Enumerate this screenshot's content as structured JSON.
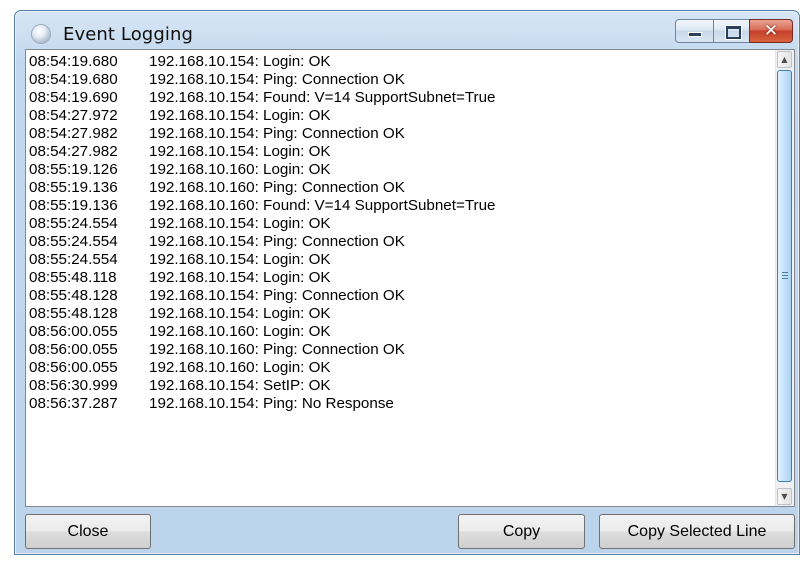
{
  "window": {
    "title": "Event Logging",
    "icons": {
      "app": "app-icon",
      "minimize": "minimize-icon",
      "maximize": "maximize-icon",
      "close": "close-icon"
    },
    "close_glyph": "✕"
  },
  "log": {
    "lines": [
      {
        "time": "08:54:19.680",
        "message": "192.168.10.154: Login: OK"
      },
      {
        "time": "08:54:19.680",
        "message": "192.168.10.154: Ping: Connection OK"
      },
      {
        "time": "08:54:19.690",
        "message": "192.168.10.154: Found: V=14 SupportSubnet=True"
      },
      {
        "time": "08:54:27.972",
        "message": "192.168.10.154: Login: OK"
      },
      {
        "time": "08:54:27.982",
        "message": "192.168.10.154: Ping: Connection OK"
      },
      {
        "time": "08:54:27.982",
        "message": "192.168.10.154: Login: OK"
      },
      {
        "time": "08:55:19.126",
        "message": "192.168.10.160: Login: OK"
      },
      {
        "time": "08:55:19.136",
        "message": "192.168.10.160: Ping: Connection OK"
      },
      {
        "time": "08:55:19.136",
        "message": "192.168.10.160: Found: V=14 SupportSubnet=True"
      },
      {
        "time": "08:55:24.554",
        "message": "192.168.10.154: Login: OK"
      },
      {
        "time": "08:55:24.554",
        "message": "192.168.10.154: Ping: Connection OK"
      },
      {
        "time": "08:55:24.554",
        "message": "192.168.10.154: Login: OK"
      },
      {
        "time": "08:55:48.118",
        "message": "192.168.10.154: Login: OK"
      },
      {
        "time": "08:55:48.128",
        "message": "192.168.10.154: Ping: Connection OK"
      },
      {
        "time": "08:55:48.128",
        "message": "192.168.10.154: Login: OK"
      },
      {
        "time": "08:56:00.055",
        "message": "192.168.10.160: Login: OK"
      },
      {
        "time": "08:56:00.055",
        "message": "192.168.10.160: Ping: Connection OK"
      },
      {
        "time": "08:56:00.055",
        "message": "192.168.10.160: Login: OK"
      },
      {
        "time": "08:56:30.999",
        "message": "192.168.10.154: SetIP: OK"
      },
      {
        "time": "08:56:37.287",
        "message": "192.168.10.154: Ping: No Response"
      }
    ],
    "scrollbar": {
      "up_glyph": "▲",
      "down_glyph": "▼"
    }
  },
  "buttons": {
    "close": "Close",
    "copy": "Copy",
    "copy_selected_line": "Copy Selected Line"
  },
  "colors": {
    "title_bar": "#c2d8ef",
    "close_button": "#c4402a",
    "scroll_thumb": "#c4e3fa"
  }
}
